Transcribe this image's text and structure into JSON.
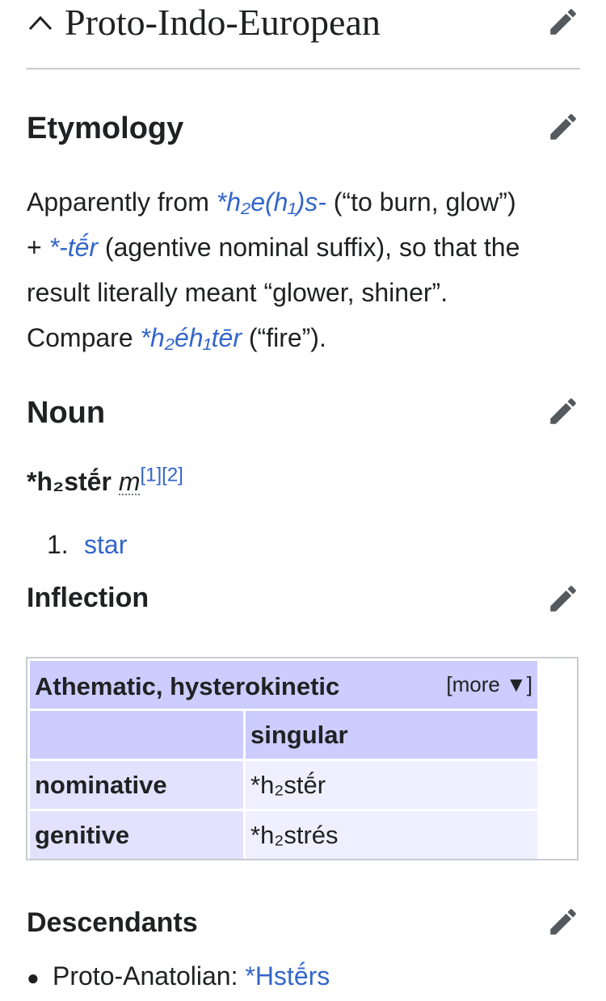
{
  "language": {
    "title": "Proto-Indo-European"
  },
  "etymology": {
    "heading": "Etymology",
    "line1_pre": "Apparently from ",
    "root1": "*h₂e(h₁)s-",
    "line1_post": " (“to burn, glow”)",
    "line2_pre": "+ ",
    "suffix": "*-tḗr",
    "line2_post": " (agentive nominal suffix), so that the",
    "line3": "result literally meant “glower, shiner”.",
    "line4_pre": "Compare ",
    "compare": "*h₂éh₁tēr",
    "line4_post": " (“fire”)."
  },
  "noun": {
    "heading": "Noun",
    "headword": "*h₂stḗr",
    "gender": "m",
    "cite1": "[1]",
    "cite2": "[2]",
    "senses": [
      {
        "num": "1.",
        "text": "star"
      }
    ]
  },
  "inflection": {
    "heading": "Inflection",
    "table_title": "Athematic, hysterokinetic",
    "more_label": "[more ▼]",
    "column_header": "singular",
    "rows": [
      {
        "label": "nominative",
        "value": "*h₂stḗr"
      },
      {
        "label": "genitive",
        "value": "*h₂strés"
      }
    ]
  },
  "descendants": {
    "heading": "Descendants",
    "items": [
      {
        "label": "Proto-Anatolian: ",
        "link": "*Hstḗrs"
      }
    ]
  },
  "icons": {
    "edit": "pencil-icon",
    "collapse": "chevron-up-icon"
  },
  "colors": {
    "link": "#3366cc",
    "table_header": "#ccccff",
    "table_label": "#e2e2ff",
    "table_cell": "#efefff"
  }
}
